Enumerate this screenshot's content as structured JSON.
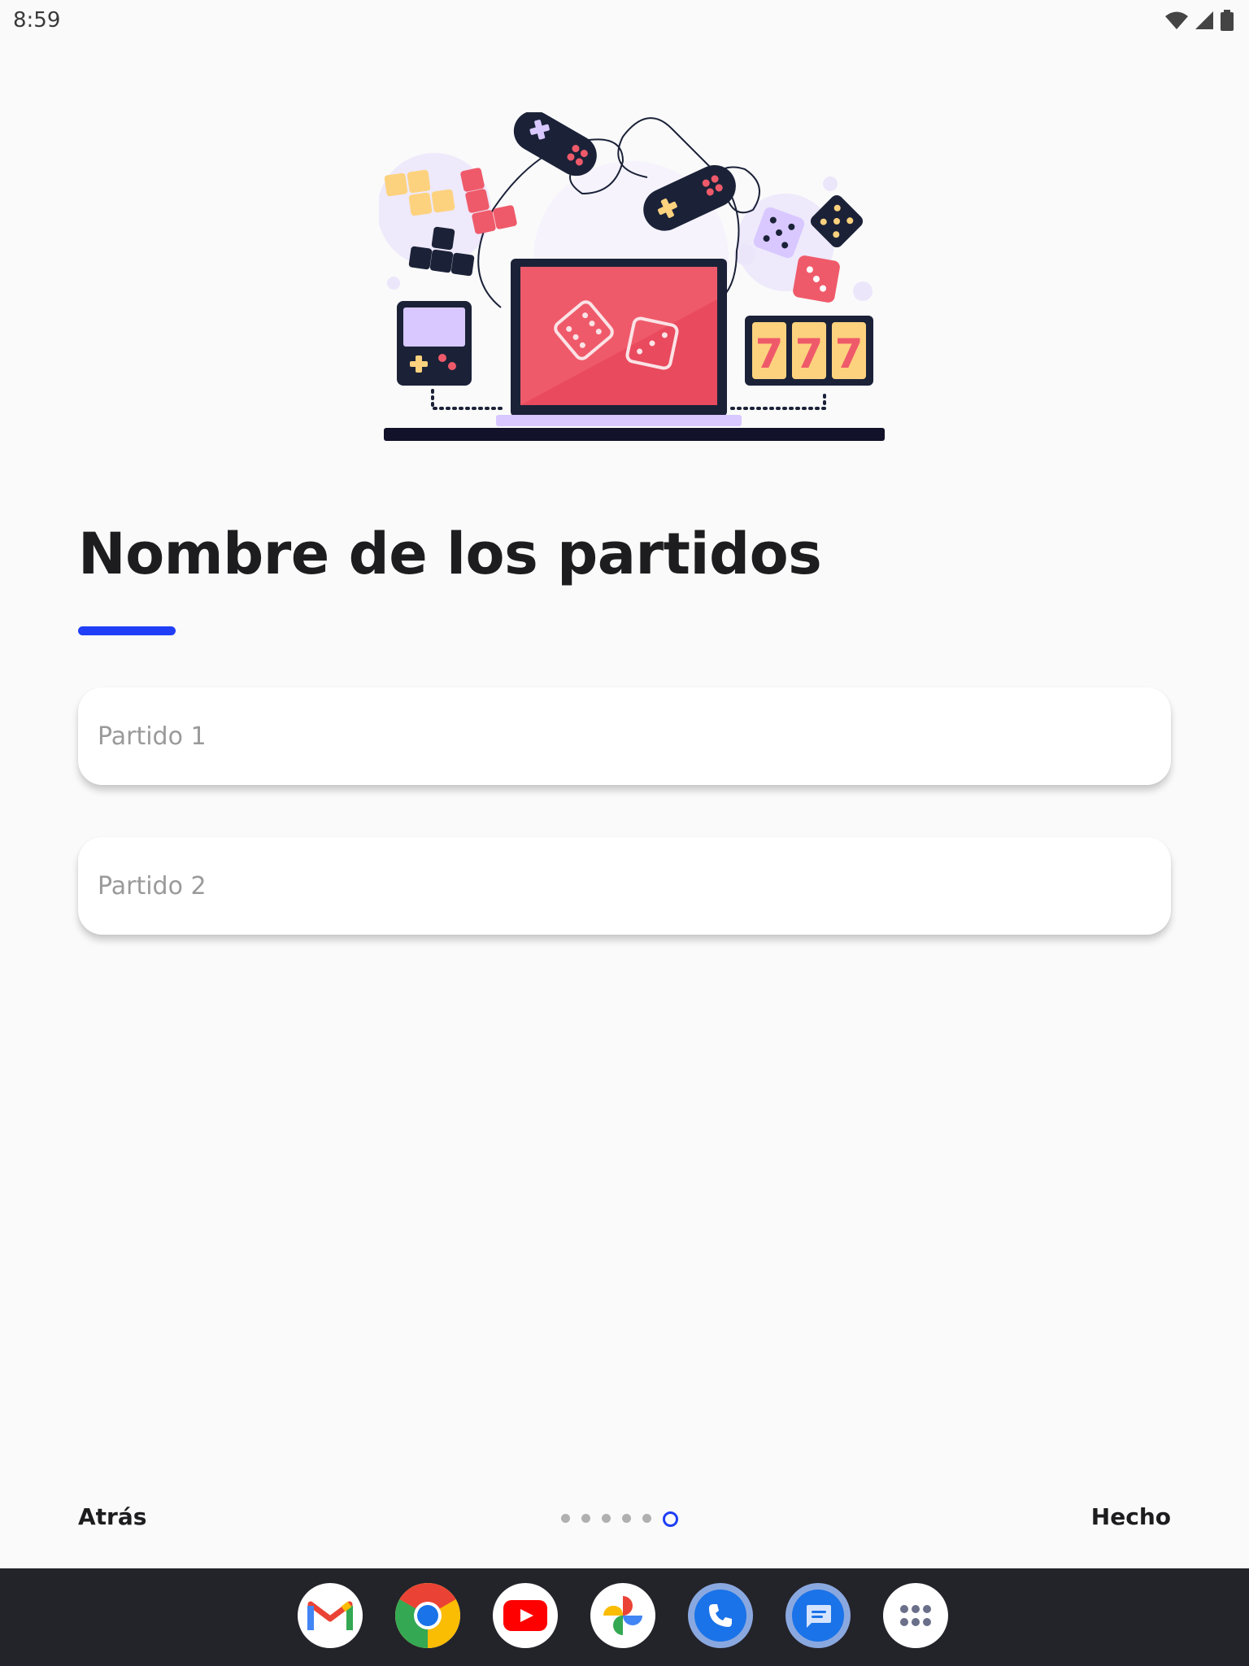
{
  "status_bar": {
    "time": "8:59",
    "icons": [
      "wifi-icon",
      "cell-signal-icon",
      "battery-icon"
    ]
  },
  "hero": {
    "icon": "games-illustration",
    "slot_text": "777"
  },
  "title": "Nombre de los partidos",
  "accent_color": "#1f3ef5",
  "fields": [
    {
      "placeholder": "Partido 1",
      "value": ""
    },
    {
      "placeholder": "Partido 2",
      "value": ""
    }
  ],
  "footer": {
    "back_label": "Atrás",
    "done_label": "Hecho",
    "page_count": 6,
    "current_page": 6
  },
  "dock": {
    "apps": [
      "gmail-icon",
      "chrome-icon",
      "youtube-icon",
      "photos-icon",
      "phone-icon",
      "messages-icon",
      "app-drawer-icon"
    ]
  }
}
